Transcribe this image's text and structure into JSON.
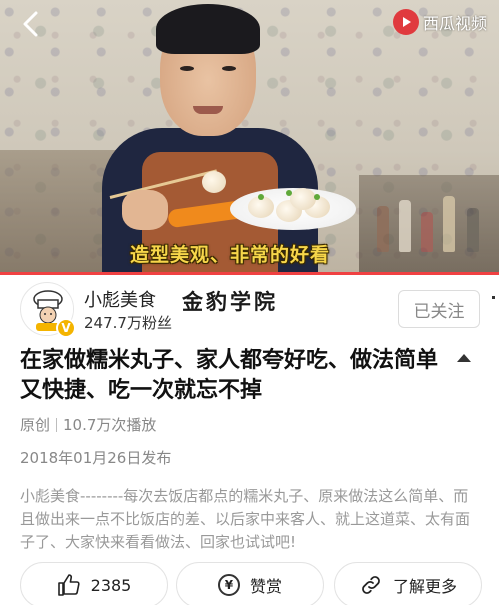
{
  "video": {
    "caption": "造型美观、非常的好看",
    "brand_name": "西瓜视频",
    "back_icon": "chevron-left-icon",
    "brand_icon": "play-circle-icon",
    "brand_color": "#e03a3e",
    "caption_color": "#f7d64a",
    "progress_fraction": 1.0,
    "progress_color": "#f04142"
  },
  "author": {
    "name": "小彪美食",
    "fans": "247.7万粉丝",
    "avatar_icon": "chef-avatar-icon",
    "verified_badge": "V",
    "follow_label": "已关注",
    "watermark": "金豹学院"
  },
  "article": {
    "title": "在家做糯米丸子、家人都夸好吃、做法简单又快捷、吃一次就忘不掉",
    "collapse_icon": "triangle-up-icon",
    "origin": "原创",
    "plays": "10.7万次播放",
    "publish_date": "2018年01月26日发布",
    "description": "小彪美食--------每次去饭店都点的糯米丸子、原来做法这么简单、而且做出来一点不比饭店的差、以后家中来客人、就上这道菜、太有面子了、大家快来看看做法、回家也试试吧!"
  },
  "actions": {
    "like_count": "2385",
    "like_icon": "thumbs-up-icon",
    "reward_label": "赞赏",
    "reward_icon": "yuan-coin-icon",
    "more_label": "了解更多",
    "more_icon": "link-icon"
  }
}
